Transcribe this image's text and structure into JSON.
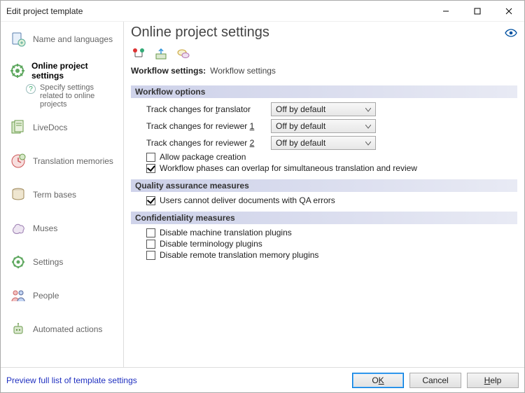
{
  "window": {
    "title": "Edit project template"
  },
  "sidebar": {
    "items": [
      {
        "label": "Name and languages"
      },
      {
        "label": "Online project settings"
      },
      {
        "label": "LiveDocs"
      },
      {
        "label": "Translation memories"
      },
      {
        "label": "Term bases"
      },
      {
        "label": "Muses"
      },
      {
        "label": "Settings"
      },
      {
        "label": "People"
      },
      {
        "label": "Automated actions"
      }
    ],
    "helptext": "Specify settings related to online projects"
  },
  "main": {
    "title": "Online project settings",
    "workflow_line": {
      "label": "Workflow settings:",
      "value": "Workflow settings"
    },
    "sections": {
      "workflow_options": {
        "title": "Workflow options",
        "track_translator": {
          "label_pre": "Track changes for ",
          "label_u": "t",
          "label_post": "ranslator",
          "value": "Off by default"
        },
        "track_reviewer1": {
          "label_pre": "Track changes for reviewer ",
          "label_u": "1",
          "label_post": "",
          "value": "Off by default"
        },
        "track_reviewer2": {
          "label_pre": "Track changes for reviewer ",
          "label_u": "2",
          "label_post": "",
          "value": "Off by default"
        },
        "allow_package": {
          "checked": false,
          "label": "Allow package creation"
        },
        "overlap": {
          "checked": true,
          "label": "Workflow phases can overlap for simultaneous translation and review"
        }
      },
      "qa": {
        "title": "Quality assurance measures",
        "users_cannot_deliver": {
          "checked": true,
          "label": "Users cannot deliver documents with QA errors"
        }
      },
      "conf": {
        "title": "Confidentiality measures",
        "disable_mt": {
          "checked": false,
          "label": "Disable machine translation plugins"
        },
        "disable_term": {
          "checked": false,
          "label": "Disable terminology plugins"
        },
        "disable_tm": {
          "checked": false,
          "label": "Disable remote translation memory plugins"
        }
      }
    }
  },
  "footer": {
    "preview_link": "Preview full list of template settings",
    "ok_pre": "O",
    "ok_u": "K",
    "cancel": "Cancel",
    "help_u": "H",
    "help_post": "elp"
  }
}
